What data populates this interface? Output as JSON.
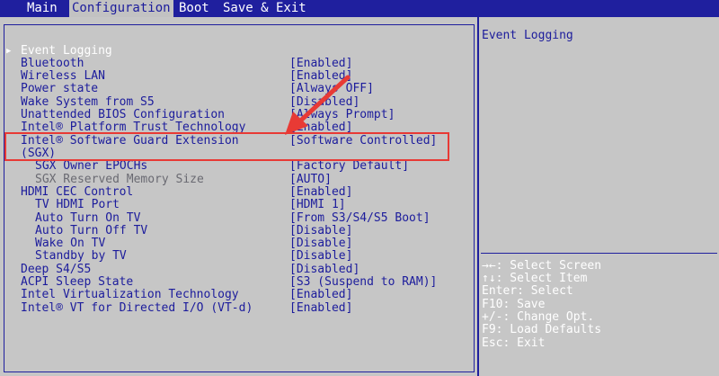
{
  "tabs": [
    "Main",
    "Configuration",
    "Boot",
    "Save & Exit"
  ],
  "active_tab": "Configuration",
  "selected_item": "Event Logging",
  "items": [
    {
      "label": "Event Logging",
      "value": ""
    },
    {
      "label": "Bluetooth",
      "value": "[Enabled]"
    },
    {
      "label": "Wireless LAN",
      "value": "[Enabled]"
    },
    {
      "label": "Power state",
      "value": "[Always OFF]"
    },
    {
      "label": "Wake System from S5",
      "value": "[Disabled]"
    },
    {
      "label": "Unattended BIOS Configuration",
      "value": "[Always Prompt]"
    },
    {
      "label": "Intel® Platform Trust Technology",
      "value": "[Enabled]"
    },
    {
      "label": "Intel® Software Guard Extension",
      "value": "[Software Controlled]"
    },
    {
      "label": "(SGX)",
      "value": ""
    },
    {
      "label": "SGX Owner EPOCHs",
      "value": "[Factory Default]"
    },
    {
      "label": "SGX Reserved Memory Size",
      "value": "[AUTO]"
    },
    {
      "label": "HDMI CEC Control",
      "value": "[Enabled]"
    },
    {
      "label": "TV HDMI Port",
      "value": "[HDMI 1]"
    },
    {
      "label": "Auto Turn On TV",
      "value": "[From S3/S4/S5 Boot]"
    },
    {
      "label": "Auto Turn Off TV",
      "value": "[Disable]"
    },
    {
      "label": "Wake On TV",
      "value": "[Disable]"
    },
    {
      "label": "Standby by TV",
      "value": "[Disable]"
    },
    {
      "label": "Deep S4/S5",
      "value": "[Disabled]"
    },
    {
      "label": "ACPI Sleep State",
      "value": "[S3 (Suspend to RAM)]"
    },
    {
      "label": "Intel Virtualization Technology",
      "value": "[Enabled]"
    },
    {
      "label": "Intel® VT for Directed I/O (VT-d)",
      "value": "[Enabled]"
    }
  ],
  "help": {
    "title": "Event Logging",
    "keys": [
      "→←: Select Screen",
      "↑↓: Select Item",
      "Enter: Select",
      "F10: Save",
      "+/-: Change Opt.",
      "F9: Load Defaults",
      "Esc: Exit"
    ]
  },
  "colors": {
    "blue": "#1f1f9e",
    "panel": "#c6c6c6",
    "annotation_red": "#e83a35"
  }
}
